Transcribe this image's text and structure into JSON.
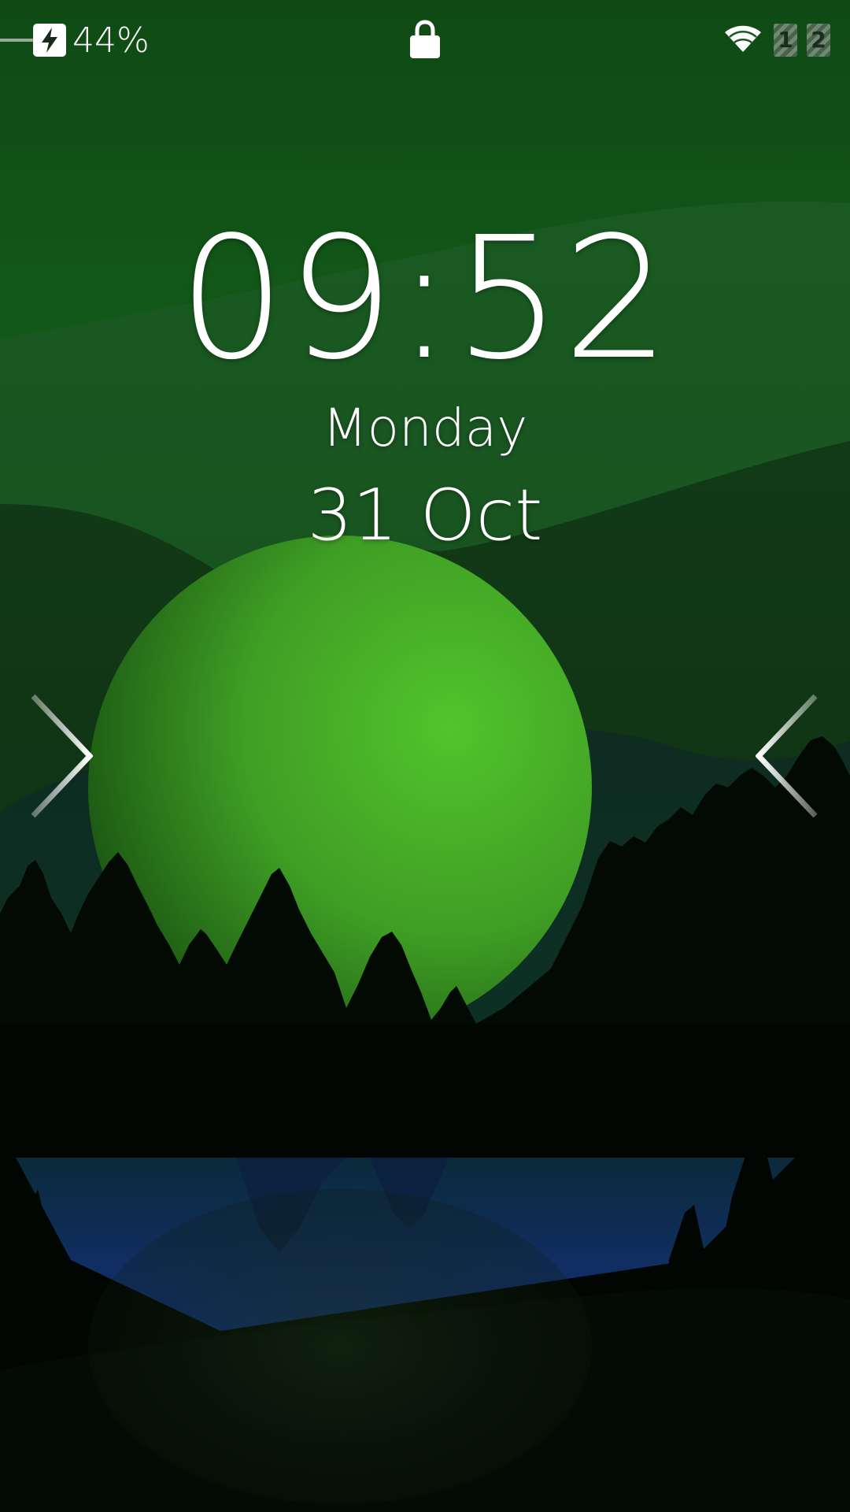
{
  "status_bar": {
    "battery_percent": "44%",
    "battery_icon": "charging-battery-icon",
    "lock_icon": "padlock-icon",
    "wifi_icon": "wifi-icon",
    "sim_slots": [
      "1",
      "2"
    ]
  },
  "clock": {
    "time": "09:52",
    "day": "Monday",
    "date": "31 Oct"
  },
  "edge_hints": {
    "left_icon": "chevron-right-icon",
    "right_icon": "chevron-left-icon"
  },
  "colors": {
    "sky_top": "#0f4a14",
    "sky_mid": "#1a6f22",
    "moon": "#4ab428",
    "lake": "#0f2a6a",
    "forest": "#020602",
    "text": "#ffffff"
  }
}
